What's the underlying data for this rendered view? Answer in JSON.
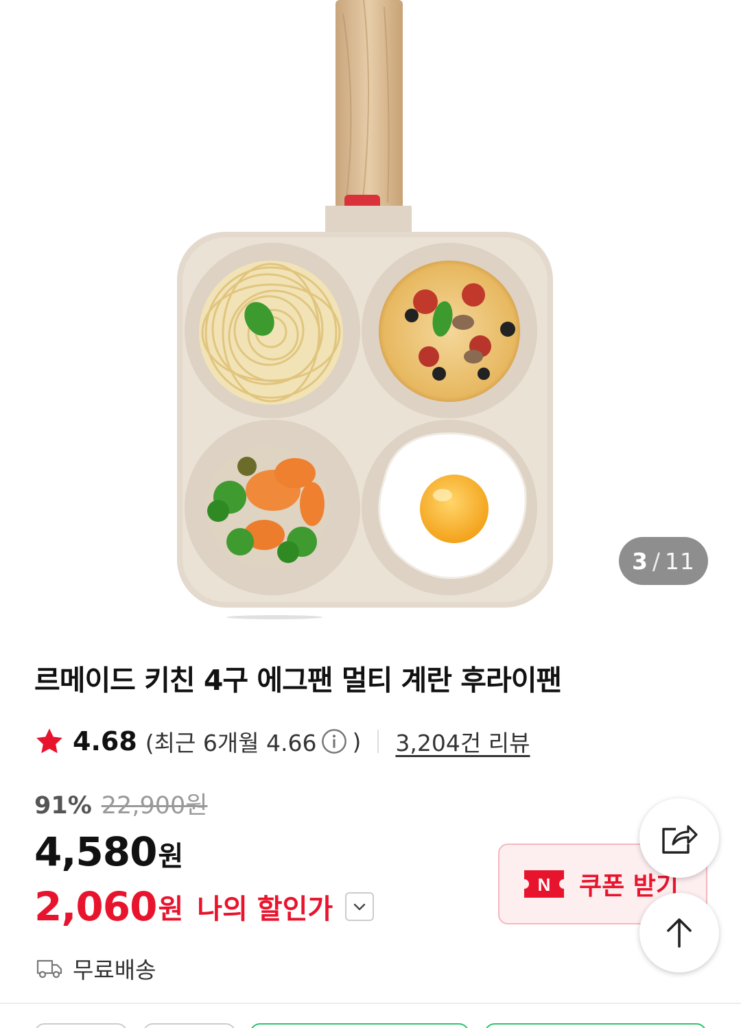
{
  "gallery": {
    "current": "3",
    "separator": "/",
    "total": "11",
    "image_subject": "4-compartment square egg pan with pasta, pizza, vegetables and a fried egg"
  },
  "product": {
    "title": "르메이드 키친 4구 에그팬 멀티 계란 후라이팬"
  },
  "rating": {
    "score": "4.68",
    "recent_label": "(최근 6개월 4.66",
    "recent_close": ")",
    "review_count": "3,204건 리뷰",
    "icons": {
      "star": "star-icon",
      "info": "info-icon"
    }
  },
  "price": {
    "discount_rate": "91%",
    "original": "22,900원",
    "sale_number": "4,580",
    "sale_unit": "원",
    "my_price_number": "2,060",
    "my_price_unit": "원",
    "my_price_label": "나의 할인가"
  },
  "shipping": {
    "label": "무료배송"
  },
  "coupon": {
    "label": "쿠폰 받기",
    "badge": "N"
  },
  "colors": {
    "accent_red": "#e8142d",
    "coupon_bg": "#fdeef0",
    "coupon_border": "#f5b7c0",
    "indicator_bg": "#6e6e6e",
    "chip_green": "#2bc56b"
  }
}
